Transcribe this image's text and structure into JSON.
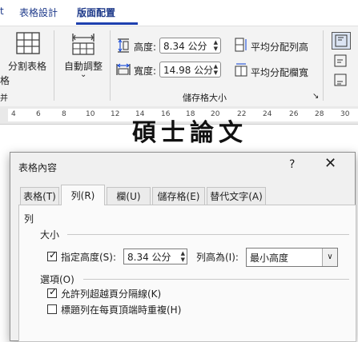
{
  "ribbon": {
    "tabs": [
      {
        "label": "t"
      },
      {
        "label": "表格設計"
      },
      {
        "label": "版面配置",
        "active": true
      }
    ],
    "split_table": "分割表格",
    "autofit": "自動調整",
    "height_label": "高度:",
    "height_value": "8.34 公分",
    "width_label": "寬度:",
    "width_value": "14.98 公分",
    "distribute_rows": "平均分配列高",
    "distribute_cols": "平均分配欄寬",
    "cell_size_group": "儲存格大小"
  },
  "ruler": {
    "numbers": [
      "4",
      "6",
      "8",
      "10",
      "12",
      "14",
      "16",
      "18",
      "20",
      "22",
      "24",
      "26",
      "28",
      "30"
    ]
  },
  "document": {
    "title_text": "碩士論文"
  },
  "dialog": {
    "title": "表格內容",
    "help": "?",
    "close": "✕",
    "tabs": [
      {
        "label": "表格(T)"
      },
      {
        "label": "列(R)",
        "active": true
      },
      {
        "label": "欄(U)"
      },
      {
        "label": "儲存格(E)"
      },
      {
        "label": "替代文字(A)"
      }
    ],
    "section_row": "列",
    "size_label": "大小",
    "specify_height_label": "指定高度(S):",
    "specify_height_checked": true,
    "height_value": "8.34 公分",
    "row_height_is_label": "列高為(I):",
    "row_height_is_value": "最小高度",
    "options_label": "選項(O)",
    "allow_break": "允許列超越頁分隔線(K)",
    "allow_break_checked": true,
    "repeat_header": "標題列在每頁頂端時重複(H)",
    "repeat_header_checked": false
  }
}
